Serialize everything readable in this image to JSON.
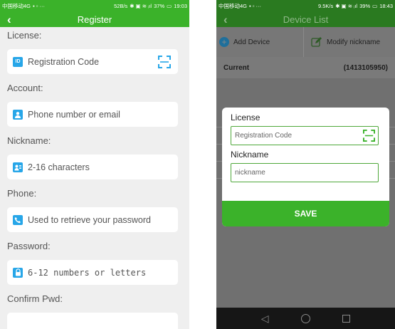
{
  "left": {
    "status": {
      "carrier": "中国移动4G",
      "speed": "52B/s",
      "battery": "37%",
      "time": "19:03"
    },
    "header": {
      "title": "Register"
    },
    "fields": [
      {
        "label": "License:",
        "placeholder": "Registration Code",
        "icon": "id-card-icon"
      },
      {
        "label": "Account:",
        "placeholder": "Phone number or email",
        "icon": "person-icon"
      },
      {
        "label": "Nickname:",
        "placeholder": "2-16 characters",
        "icon": "contact-card-icon"
      },
      {
        "label": "Phone:",
        "placeholder": "Used to retrieve your password",
        "icon": "phone-icon"
      },
      {
        "label": "Password:",
        "placeholder": "6-12 numbers or letters",
        "icon": "lock-icon"
      },
      {
        "label": "Confirm Pwd:"
      }
    ]
  },
  "right": {
    "status": {
      "carrier": "中国移动4G",
      "speed": "9.5K/s",
      "battery": "39%",
      "time": "18:43"
    },
    "header": {
      "title": "Device List"
    },
    "toolbar": {
      "add_label": "Add Device",
      "modify_label": "Modify nickname"
    },
    "current": {
      "label": "Current",
      "value": "(1413105950)"
    },
    "dialog": {
      "license_label": "License",
      "license_placeholder": "Registration Code",
      "nickname_label": "Nickname",
      "nickname_placeholder": "nickname",
      "save_label": "SAVE"
    }
  },
  "colors": {
    "accent": "#3bb22a",
    "icon_blue": "#27a6e8"
  }
}
